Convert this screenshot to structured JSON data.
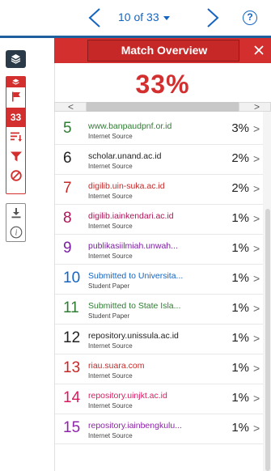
{
  "nav": {
    "counter": "10 of 33"
  },
  "toolbar": {
    "match_count": "33"
  },
  "panel": {
    "title": "Match Overview",
    "overall_percent": "33%"
  },
  "colors": {
    "accent_red": "#d32f2f",
    "nav_blue": "#1565c0"
  },
  "sources": [
    {
      "rank": "5",
      "name": "www.banpaudpnf.or.id",
      "type": "Internet Source",
      "percent": "3%",
      "color": "#2e7d32"
    },
    {
      "rank": "6",
      "name": "scholar.unand.ac.id",
      "type": "Internet Source",
      "percent": "2%",
      "color": "#222222"
    },
    {
      "rank": "7",
      "name": "digilib.uin-suka.ac.id",
      "type": "Internet Source",
      "percent": "2%",
      "color": "#c62828"
    },
    {
      "rank": "8",
      "name": "digilib.iainkendari.ac.id",
      "type": "Internet Source",
      "percent": "1%",
      "color": "#ad1457"
    },
    {
      "rank": "9",
      "name": "publikasiilmiah.unwah...",
      "type": "Internet Source",
      "percent": "1%",
      "color": "#7b1fa2"
    },
    {
      "rank": "10",
      "name": "Submitted to Universita...",
      "type": "Student Paper",
      "percent": "1%",
      "color": "#1565c0"
    },
    {
      "rank": "11",
      "name": "Submitted to State Isla...",
      "type": "Student Paper",
      "percent": "1%",
      "color": "#2e7d32"
    },
    {
      "rank": "12",
      "name": "repository.unissula.ac.id",
      "type": "Internet Source",
      "percent": "1%",
      "color": "#222222"
    },
    {
      "rank": "13",
      "name": "riau.suara.com",
      "type": "Internet Source",
      "percent": "1%",
      "color": "#c62828"
    },
    {
      "rank": "14",
      "name": "repository.uinjkt.ac.id",
      "type": "Internet Source",
      "percent": "1%",
      "color": "#d81b60"
    },
    {
      "rank": "15",
      "name": "repository.iainbengkulu...",
      "type": "Internet Source",
      "percent": "1%",
      "color": "#8e24aa"
    }
  ]
}
